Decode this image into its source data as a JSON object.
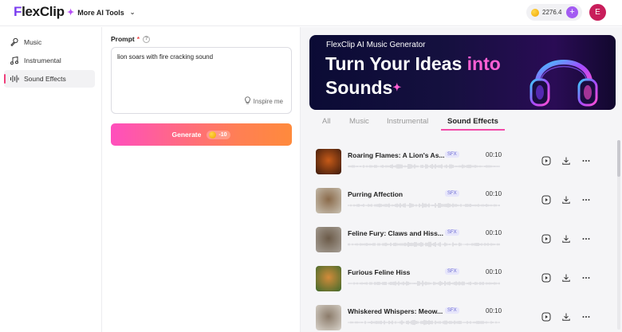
{
  "header": {
    "logo_prefix": "F",
    "logo_rest": "lexClip",
    "more_tools_label": "More AI Tools",
    "credits": "2276.4",
    "plus_label": "+",
    "avatar_letter": "E"
  },
  "sidebar": {
    "items": [
      {
        "label": "Music",
        "icon": "microphone-icon"
      },
      {
        "label": "Instrumental",
        "icon": "music-note-icon"
      },
      {
        "label": "Sound Effects",
        "icon": "soundwave-icon",
        "active": true
      }
    ]
  },
  "prompt": {
    "label": "Prompt",
    "required_mark": "*",
    "help_mark": "?",
    "value": "lion soars with fire cracking sound",
    "inspire_label": "Inspire me",
    "generate_label": "Generate",
    "cost": "-10"
  },
  "banner": {
    "subtitle": "FlexClip AI Music Generator",
    "title_part1": "Turn Your Ideas ",
    "title_highlight": "into",
    "title_part2": "Sounds"
  },
  "tabs": [
    {
      "label": "All"
    },
    {
      "label": "Music"
    },
    {
      "label": "Instrumental"
    },
    {
      "label": "Sound Effects",
      "active": true
    }
  ],
  "tracks": [
    {
      "title": "Roaring Flames: A Lion's As...",
      "badge": "SFX",
      "duration": "00:10",
      "thumb_colors": [
        "#3b1a0c",
        "#c65a18"
      ]
    },
    {
      "title": "Purring Affection",
      "badge": "SFX",
      "duration": "00:10",
      "thumb_colors": [
        "#c9c2b4",
        "#8a6a4a"
      ]
    },
    {
      "title": "Feline Fury: Claws and Hiss...",
      "badge": "SFX",
      "duration": "00:10",
      "thumb_colors": [
        "#a8a198",
        "#6b5a48"
      ]
    },
    {
      "title": "Furious Feline Hiss",
      "badge": "SFX",
      "duration": "00:10",
      "thumb_colors": [
        "#3f6a2c",
        "#d38b3a"
      ]
    },
    {
      "title": "Whiskered Whispers: Meow...",
      "badge": "SFX",
      "duration": "00:10",
      "thumb_colors": [
        "#d9d4cc",
        "#8b7b6a"
      ]
    }
  ],
  "colors": {
    "accent": "#f24aa8",
    "brand_purple": "#7a3cf0",
    "avatar": "#c81e5b"
  }
}
